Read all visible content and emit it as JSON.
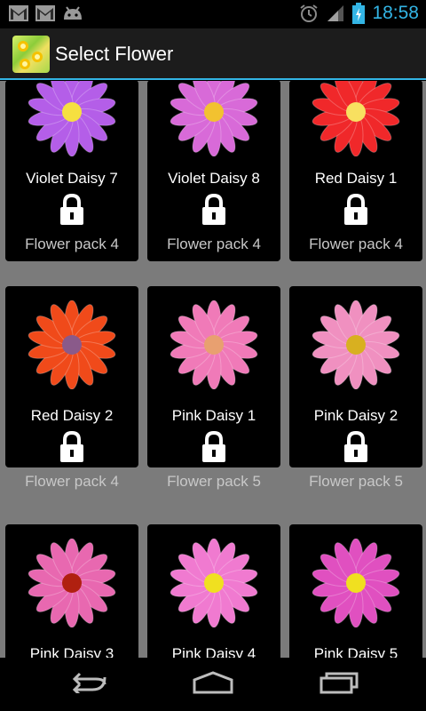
{
  "status_bar": {
    "time": "18:58",
    "icons": [
      "gmail-icon",
      "gmail-icon",
      "android-icon",
      "alarm-icon",
      "signal-icon",
      "battery-icon"
    ]
  },
  "action_bar": {
    "title": "Select Flower",
    "icon": "flower-app-icon"
  },
  "flowers": [
    {
      "name": "Violet Daisy 7",
      "pack": "Flower pack 4",
      "petal_color": "#b45ee8",
      "center_color": "#f6e040",
      "locked": true
    },
    {
      "name": "Violet Daisy 8",
      "pack": "Flower pack 4",
      "petal_color": "#d86ad8",
      "center_color": "#f2c230",
      "locked": true
    },
    {
      "name": "Red Daisy 1",
      "pack": "Flower pack 4",
      "petal_color": "#f0282a",
      "center_color": "#f8e060",
      "locked": true
    },
    {
      "name": "Red Daisy 2",
      "pack": "Flower pack 4",
      "petal_color": "#f04a1a",
      "center_color": "#8a5a8a",
      "locked": true
    },
    {
      "name": "Pink Daisy 1",
      "pack": "Flower pack 5",
      "petal_color": "#f07ab8",
      "center_color": "#e8a070",
      "locked": true
    },
    {
      "name": "Pink Daisy 2",
      "pack": "Flower pack 5",
      "petal_color": "#f090c0",
      "center_color": "#d8b020",
      "locked": true
    },
    {
      "name": "Pink Daisy 3",
      "pack": "",
      "petal_color": "#e868b0",
      "center_color": "#b02010",
      "locked": true
    },
    {
      "name": "Pink Daisy 4",
      "pack": "",
      "petal_color": "#f07ad0",
      "center_color": "#f0e020",
      "locked": true
    },
    {
      "name": "Pink Daisy 5",
      "pack": "",
      "petal_color": "#e050c0",
      "center_color": "#f0e020",
      "locked": true
    }
  ],
  "nav_bar": {
    "back": "back-icon",
    "home": "home-icon",
    "recents": "recents-icon"
  }
}
